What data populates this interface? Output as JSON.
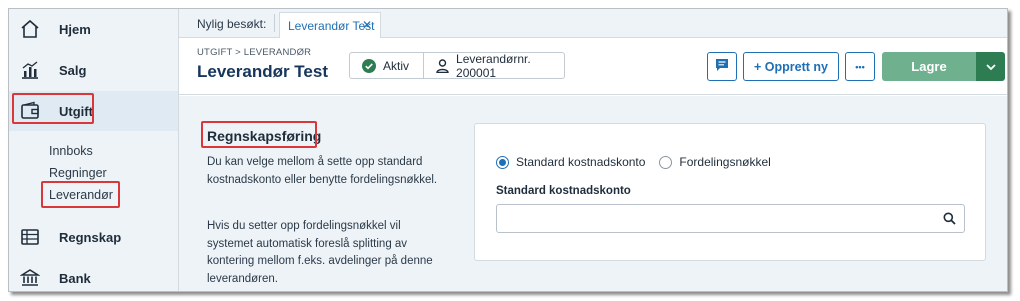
{
  "sidebar": {
    "items": [
      {
        "label": "Hjem",
        "icon": "home-icon"
      },
      {
        "label": "Salg",
        "icon": "bar-chart-icon"
      },
      {
        "label": "Utgift",
        "icon": "wallet-icon"
      },
      {
        "label": "Regnskap",
        "icon": "ledger-icon"
      },
      {
        "label": "Bank",
        "icon": "bank-icon"
      }
    ],
    "subitems": [
      {
        "label": "Innboks"
      },
      {
        "label": "Regninger"
      },
      {
        "label": "Leverandør"
      }
    ]
  },
  "tabs": {
    "recent_label": "Nylig besøkt:",
    "active_label": "Leverandør Test",
    "close_glyph": "✕"
  },
  "header": {
    "breadcrumb": "UTGIFT > LEVERANDØR",
    "title": "Leverandør Test",
    "status": "Aktiv",
    "supplier_number": "Leverandørnr. 200001",
    "create_new_label": "+ Opprett ny",
    "more_label": "•••",
    "save_label": "Lagre"
  },
  "accounting": {
    "title": "Regnskapsføring",
    "paragraph1": "Du kan velge mellom å sette opp standard kostnadskonto eller benytte fordelingsnøkkel.",
    "paragraph2": "Hvis du setter opp fordelingsnøkkel vil systemet automatisk foreslå splitting av kontering mellom f.eks. avdelinger på denne leverandøren.",
    "option_standard": "Standard kostnadskonto",
    "option_distribution": "Fordelingsnøkkel",
    "selected_option": "Standard kostnadskonto",
    "field_label": "Standard kostnadskonto",
    "field_value": ""
  },
  "colors": {
    "accent_blue": "#1f6fb5",
    "save_green": "#6fb08e",
    "save_green_dark": "#2e7d52",
    "status_green": "#2e7d52",
    "highlight_red": "#d9373a",
    "sidebar_bg": "#eef3f7"
  }
}
